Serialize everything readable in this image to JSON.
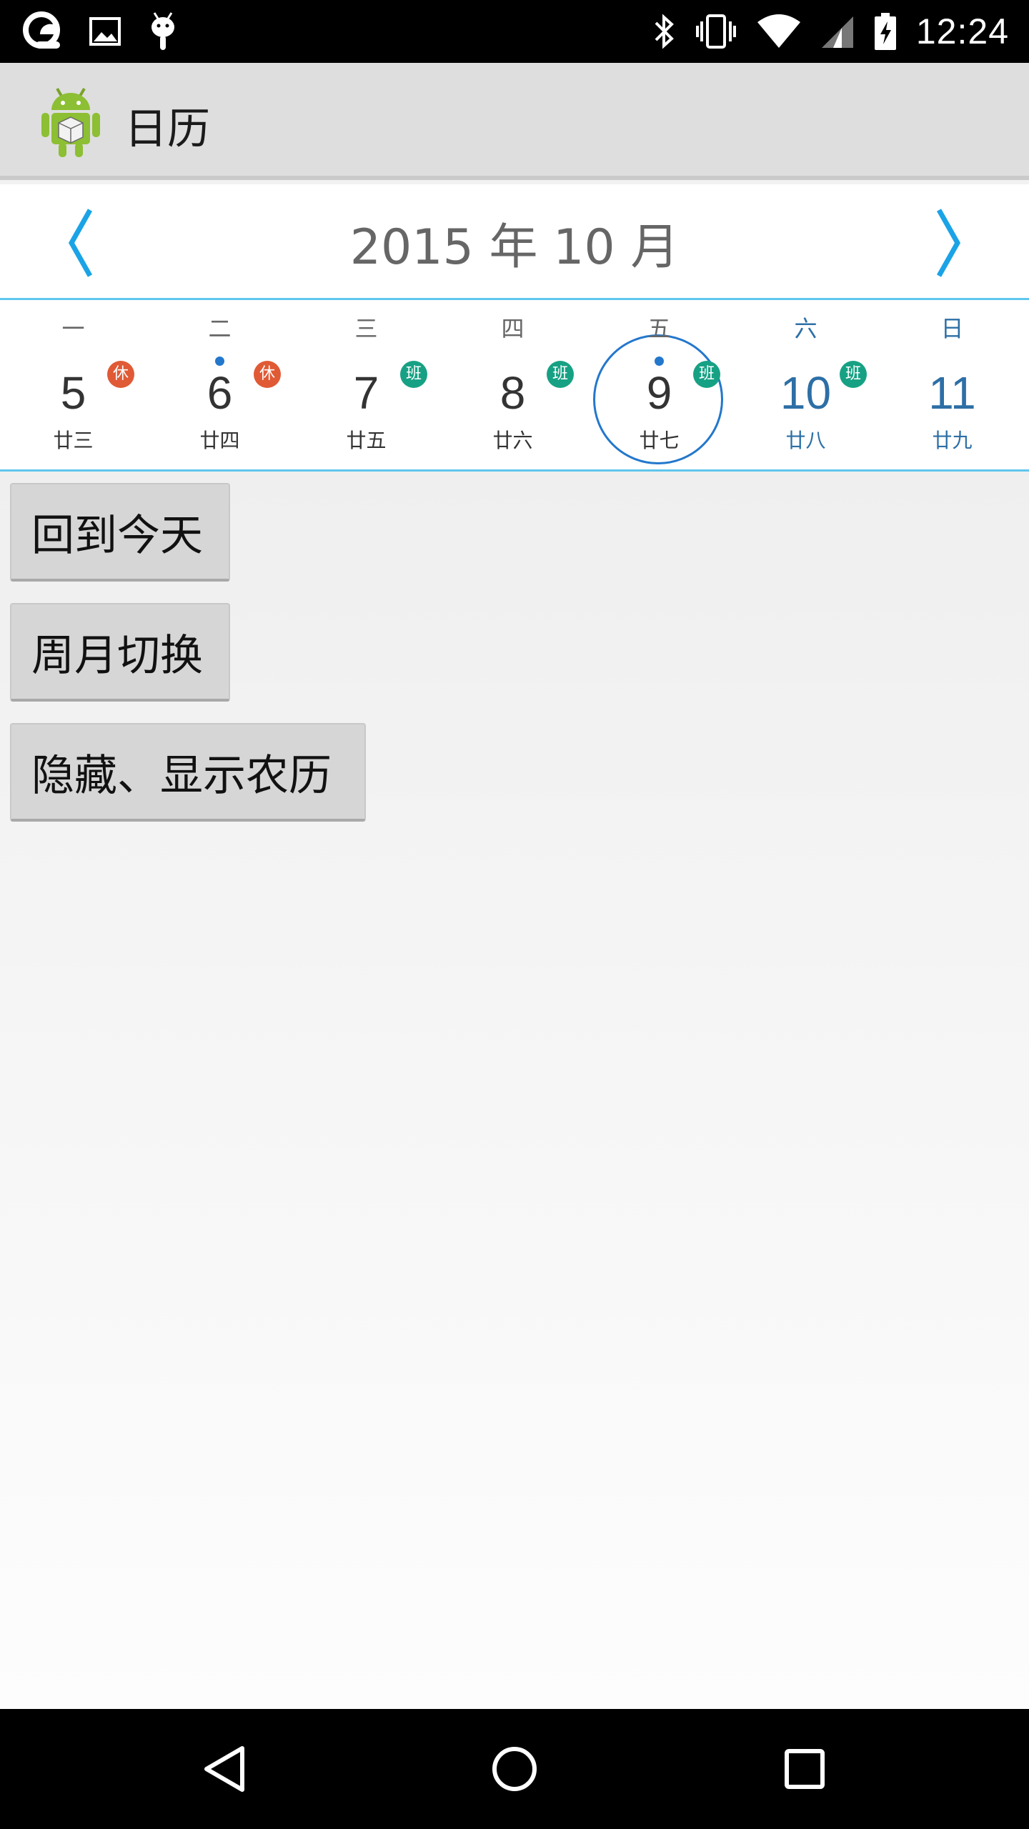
{
  "status_bar": {
    "time": "12:24",
    "icons_left": [
      "sync-cloud-icon",
      "image-icon",
      "android-debug-icon"
    ],
    "icons_right": [
      "bluetooth-icon",
      "vibrate-icon",
      "wifi-icon",
      "signal-icon",
      "battery-charging-icon"
    ]
  },
  "action_bar": {
    "title": "日历",
    "icon": "android-app-icon"
  },
  "calendar": {
    "month_title": "2015 年 10 月",
    "colors": {
      "accent": "#5fc6ee",
      "today": "#2377cc",
      "rest": "#e05a35",
      "work": "#17a184",
      "weekend": "#2d6fa6"
    },
    "days": [
      {
        "weekday": "一",
        "day": "5",
        "lunar": "廿三",
        "badge": "休",
        "badge_type": "rest",
        "event": false,
        "today": false,
        "weekend": false
      },
      {
        "weekday": "二",
        "day": "6",
        "lunar": "廿四",
        "badge": "休",
        "badge_type": "rest",
        "event": true,
        "today": false,
        "weekend": false
      },
      {
        "weekday": "三",
        "day": "7",
        "lunar": "廿五",
        "badge": "班",
        "badge_type": "work",
        "event": false,
        "today": false,
        "weekend": false
      },
      {
        "weekday": "四",
        "day": "8",
        "lunar": "廿六",
        "badge": "班",
        "badge_type": "work",
        "event": false,
        "today": false,
        "weekend": false
      },
      {
        "weekday": "五",
        "day": "9",
        "lunar": "廿七",
        "badge": "班",
        "badge_type": "work",
        "event": true,
        "today": true,
        "weekend": false
      },
      {
        "weekday": "六",
        "day": "10",
        "lunar": "廿八",
        "badge": "班",
        "badge_type": "work",
        "event": false,
        "today": false,
        "weekend": true
      },
      {
        "weekday": "日",
        "day": "11",
        "lunar": "廿九",
        "badge": "",
        "badge_type": "",
        "event": false,
        "today": false,
        "weekend": true
      }
    ]
  },
  "buttons": {
    "back_today": "回到今天",
    "switch_mode": "周月切换",
    "toggle_lunar": "隐藏、显示农历"
  }
}
